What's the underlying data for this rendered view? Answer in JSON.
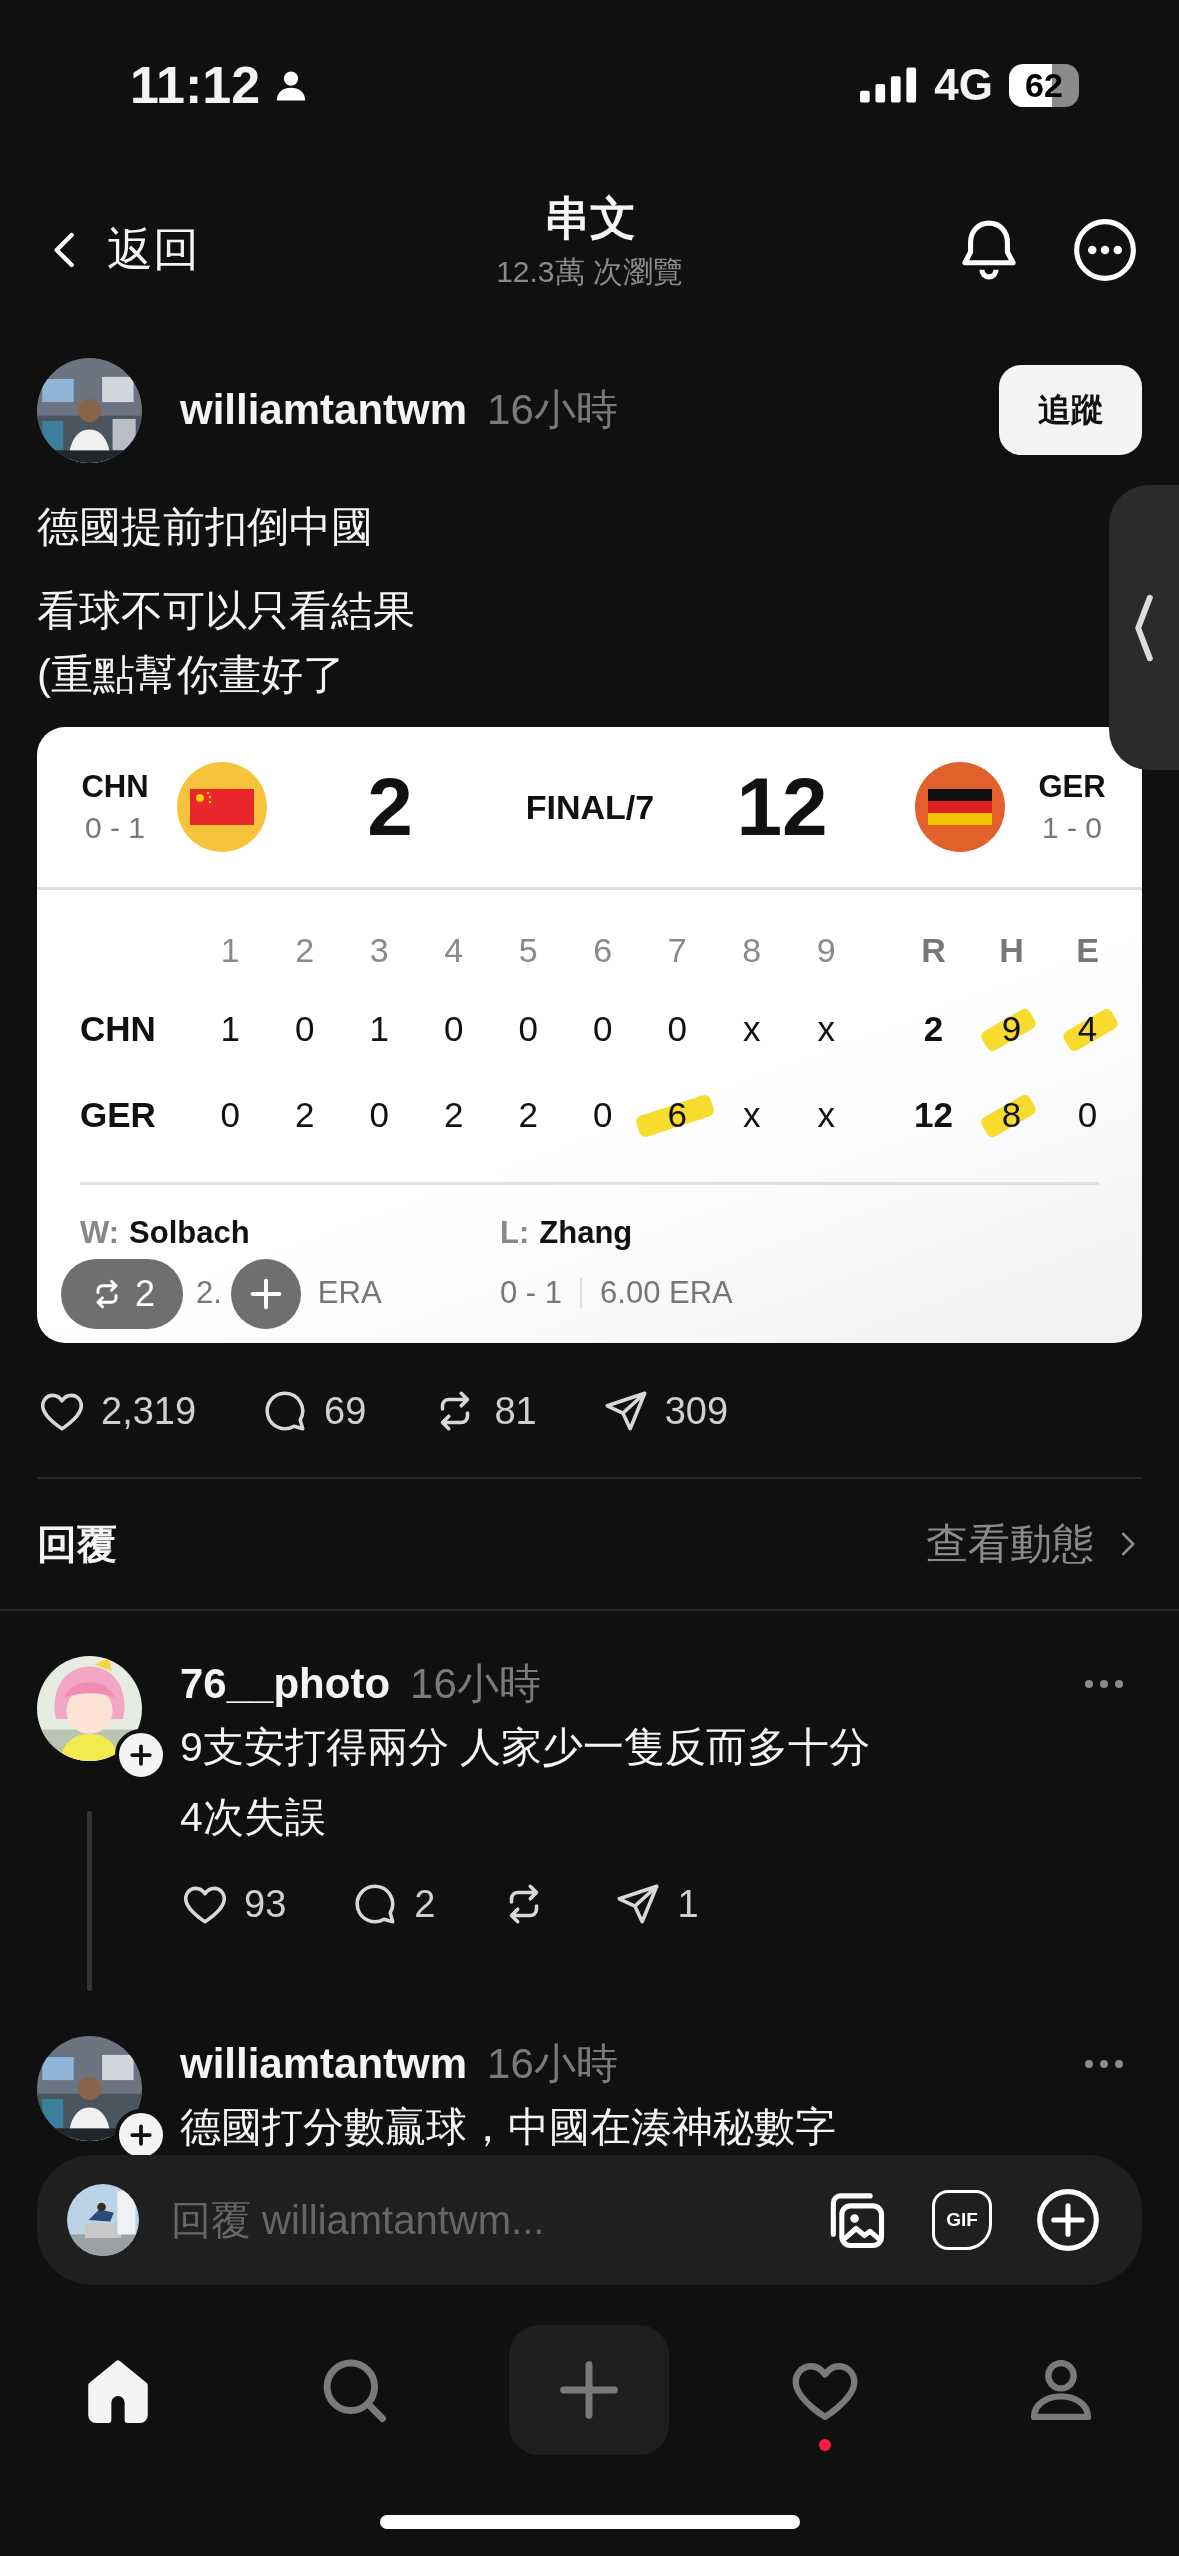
{
  "status_bar": {
    "time": "11:12",
    "network": "4G",
    "battery": "62"
  },
  "header": {
    "back_label": "返回",
    "title": "串文",
    "subtitle": "12.3萬 次瀏覽"
  },
  "post": {
    "author": "williamtantwm",
    "time": "16小時",
    "follow_label": "追蹤",
    "paragraphs": [
      [
        "德國提前扣倒中國"
      ],
      [
        "看球不可以只看結果",
        "(重點幫你畫好了"
      ]
    ],
    "scoreboard": {
      "status": "FINAL/7",
      "teams": [
        {
          "abbr": "CHN",
          "record": "0 - 1",
          "color": "#f5c43c",
          "score": "2"
        },
        {
          "abbr": "GER",
          "record": "1 - 0",
          "color": "#e2602a",
          "score": "12"
        }
      ],
      "columns": [
        "1",
        "2",
        "3",
        "4",
        "5",
        "6",
        "7",
        "8",
        "9",
        "R",
        "H",
        "E"
      ],
      "rows": [
        {
          "team": "CHN",
          "cells": [
            {
              "text": "1",
              "highlighted": false
            },
            {
              "text": "0",
              "highlighted": false
            },
            {
              "text": "1",
              "highlighted": false
            },
            {
              "text": "0",
              "highlighted": false
            },
            {
              "text": "0",
              "highlighted": false
            },
            {
              "text": "0",
              "highlighted": false
            },
            {
              "text": "0",
              "highlighted": false
            },
            {
              "text": "x",
              "highlighted": false
            },
            {
              "text": "x",
              "highlighted": false
            },
            {
              "text": "2",
              "highlighted": false
            },
            {
              "text": "9",
              "highlighted": true
            },
            {
              "text": "4",
              "highlighted": true
            }
          ]
        },
        {
          "team": "GER",
          "cells": [
            {
              "text": "0",
              "highlighted": false
            },
            {
              "text": "2",
              "highlighted": false
            },
            {
              "text": "0",
              "highlighted": false
            },
            {
              "text": "2",
              "highlighted": false
            },
            {
              "text": "2",
              "highlighted": false
            },
            {
              "text": "0",
              "highlighted": false
            },
            {
              "text": "6",
              "highlighted": true
            },
            {
              "text": "x",
              "highlighted": false
            },
            {
              "text": "x",
              "highlighted": false
            },
            {
              "text": "12",
              "highlighted": false
            },
            {
              "text": "8",
              "highlighted": true
            },
            {
              "text": "0",
              "highlighted": false
            }
          ]
        }
      ],
      "winner": {
        "label": "W:",
        "name": "Solbach",
        "stat_parts": [
          "2.",
          "ERA"
        ]
      },
      "loser": {
        "label": "L:",
        "name": "Zhang",
        "record": "0 - 1",
        "era": "6.00 ERA"
      },
      "repost_count": "2"
    },
    "actions": [
      {
        "kind": "like",
        "count": "2,319"
      },
      {
        "kind": "comment",
        "count": "69"
      },
      {
        "kind": "repost",
        "count": "81"
      },
      {
        "kind": "share",
        "count": "309"
      }
    ]
  },
  "replies": {
    "title": "回覆",
    "link": "查看動態"
  },
  "comments": [
    {
      "author": "76__photo",
      "time": "16小時",
      "lines": [
        "9支安打得兩分 人家少一隻反而多十分",
        "4次失誤"
      ],
      "actions": [
        {
          "kind": "like",
          "count": "93"
        },
        {
          "kind": "comment",
          "count": "2"
        },
        {
          "kind": "repost"
        },
        {
          "kind": "share",
          "count": "1"
        }
      ]
    },
    {
      "author": "williamtantwm",
      "time": "16小時",
      "lines": [
        "德國打分數贏球，中國在湊神秘數字"
      ]
    }
  ],
  "reply_bar": {
    "placeholder": "回覆 williamtantwm...",
    "gif_label": "GIF"
  },
  "tab_bar": [
    {
      "kind": "home",
      "selected": true,
      "dot": false
    },
    {
      "kind": "search",
      "selected": false,
      "dot": false
    },
    {
      "kind": "create",
      "selected": false,
      "dot": false
    },
    {
      "kind": "activity",
      "selected": false,
      "dot": true
    },
    {
      "kind": "profile",
      "selected": false,
      "dot": false
    }
  ]
}
